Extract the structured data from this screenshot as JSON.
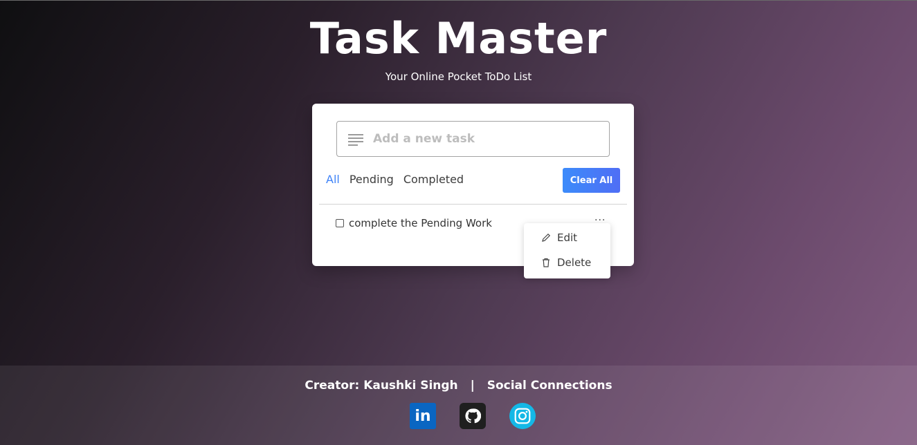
{
  "header": {
    "title": "Task Master",
    "subtitle": "Your Online Pocket ToDo List"
  },
  "task_input": {
    "placeholder": "Add a new task",
    "value": ""
  },
  "filters": {
    "all": "All",
    "pending": "Pending",
    "completed": "Completed",
    "active": "All"
  },
  "clear_all_label": "Clear All",
  "tasks": [
    {
      "text": "complete the Pending Work",
      "checked": false
    }
  ],
  "task_menu": {
    "edit": "Edit",
    "delete": "Delete"
  },
  "footer": {
    "creator_label": "Creator:",
    "creator_name": "Kaushki Singh",
    "separator": "|",
    "social_label": "Social Connections",
    "linkedin_text": "in"
  },
  "colors": {
    "accent": "#3f83f8",
    "linkedin": "#0a66c2",
    "github": "#1f1f1f",
    "instagram": "#14b8e6"
  }
}
